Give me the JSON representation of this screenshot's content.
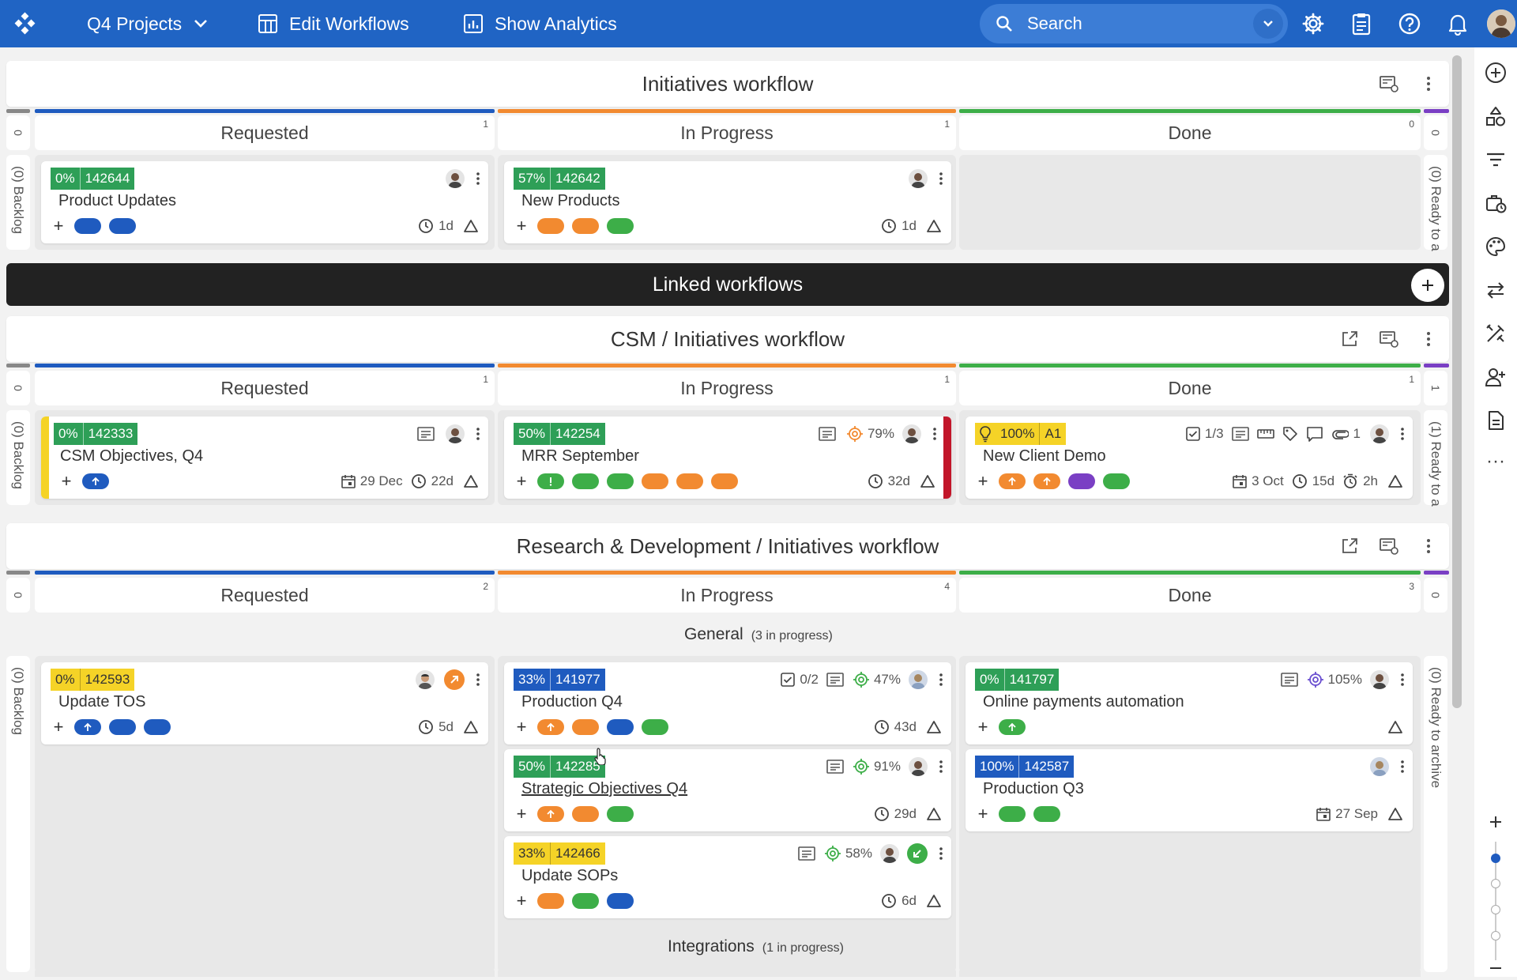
{
  "topbar": {
    "project": "Q4 Projects",
    "edit_workflows": "Edit Workflows",
    "show_analytics": "Show Analytics",
    "search_placeholder": "Search"
  },
  "initiatives": {
    "title": "Initiatives workflow",
    "columns": [
      {
        "name": "Requested",
        "count": "1"
      },
      {
        "name": "In Progress",
        "count": "1"
      },
      {
        "name": "Done",
        "count": "0"
      }
    ],
    "left_count": "0",
    "right_count": "0",
    "backlog": "(0) Backlog",
    "ready": "(0) Ready to a",
    "cards": [
      {
        "pct": "0%",
        "id": "142644",
        "title": "Product Updates",
        "time": "1d"
      },
      {
        "pct": "57%",
        "id": "142642",
        "title": "New Products",
        "time": "1d"
      }
    ]
  },
  "linked": {
    "title": "Linked workflows"
  },
  "csm": {
    "title": "CSM / Initiatives workflow",
    "columns": [
      {
        "name": "Requested",
        "count": "1"
      },
      {
        "name": "In Progress",
        "count": "1"
      },
      {
        "name": "Done",
        "count": "1"
      }
    ],
    "left_count": "0",
    "right_count": "1",
    "backlog": "(0) Backlog",
    "ready": "(1) Ready to a",
    "cards": [
      {
        "pct": "0%",
        "id": "142333",
        "title": "CSM Objectives, Q4",
        "date": "29 Dec",
        "time": "22d"
      },
      {
        "pct": "50%",
        "id": "142254",
        "title": "MRR September",
        "progress": "79%",
        "time": "32d"
      },
      {
        "pct": "100%",
        "id": "A1",
        "title": "New Client Demo",
        "checklist": "1/3",
        "attachments": "1",
        "date": "3 Oct",
        "time": "15d",
        "timer": "2h"
      }
    ]
  },
  "rd": {
    "title": "Research & Development / Initiatives workflow",
    "columns": [
      {
        "name": "Requested",
        "count": "2"
      },
      {
        "name": "In Progress",
        "count": "4"
      },
      {
        "name": "Done",
        "count": "3"
      }
    ],
    "left_count": "0",
    "right_count": "0",
    "backlog": "(0) Backlog",
    "ready": "(0) Ready to archive",
    "groups": [
      {
        "name": "General",
        "note": "(3 in progress)"
      },
      {
        "name": "Integrations",
        "note": "(1 in progress)"
      }
    ],
    "cards": [
      {
        "pct": "0%",
        "id": "142593",
        "title": "Update TOS",
        "time": "5d"
      },
      {
        "pct": "33%",
        "id": "141977",
        "title": "Production Q4",
        "checklist": "0/2",
        "progress": "47%",
        "time": "43d"
      },
      {
        "pct": "50%",
        "id": "142285",
        "title": "Strategic Objectives Q4",
        "progress": "91%",
        "time": "29d"
      },
      {
        "pct": "33%",
        "id": "142466",
        "title": "Update SOPs",
        "progress": "58%",
        "time": "6d"
      },
      {
        "pct": "0%",
        "id": "141797",
        "title": "Online payments automation",
        "progress": "105%"
      },
      {
        "pct": "100%",
        "id": "142587",
        "title": "Production Q3",
        "date": "27 Sep"
      }
    ]
  },
  "colors": {
    "topbar": "#2064c4",
    "requested": "#1f5bbf",
    "in_progress": "#f28a30",
    "done": "#3dae48",
    "archive": "#7a3fc4",
    "badge_green": "#2e9f57",
    "badge_yellow": "#f5d327",
    "badge_blue": "#1f5bbf",
    "tag_blue": "#1f5bbf",
    "tag_orange": "#f28a30",
    "tag_green": "#3dae48",
    "tag_purple": "#7a3fc4",
    "blocked_red": "#c2162a"
  },
  "icons": [
    "logo-icon",
    "chevron-down-icon",
    "table-icon",
    "chart-icon",
    "search-icon",
    "gear-icon",
    "clipboard-icon",
    "help-icon",
    "bell-icon",
    "clock-icon",
    "warning-icon",
    "calendar-icon",
    "target-icon",
    "checklist-icon",
    "note-icon",
    "tag-icon",
    "comment-icon",
    "paperclip-icon",
    "timer-icon",
    "bulb-icon",
    "more-vertical-icon",
    "external-link-icon",
    "board-settings-icon",
    "plus-circle-icon",
    "shapes-icon",
    "filter-icon",
    "briefcase-clock-icon",
    "palette-icon",
    "swap-icon",
    "tools-icon",
    "add-user-icon",
    "document-icon",
    "zoom-in-icon",
    "zoom-out-icon"
  ]
}
